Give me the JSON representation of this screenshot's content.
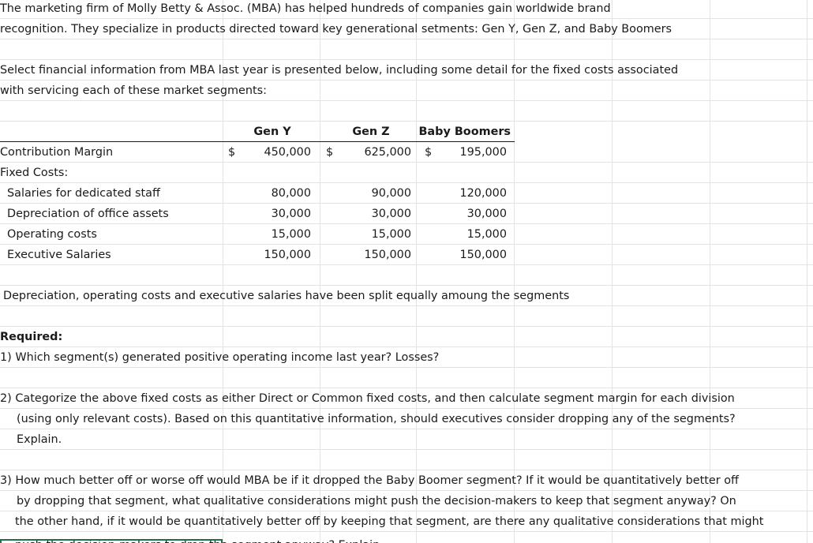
{
  "intro": {
    "line1": "The marketing firm of Molly Betty & Assoc. (MBA) has helped hundreds of companies gain worldwide brand",
    "line2": "recognition.  They specialize in products directed toward key generational setments: Gen Y, Gen Z, and Baby Boomers"
  },
  "select_info": {
    "line1": "Select financial information from MBA last year is presented below, including some detail for the fixed costs associated",
    "line2": "with servicing each of these market segments:"
  },
  "table": {
    "headers": [
      "Gen Y",
      "Gen Z",
      "Baby Boomers"
    ],
    "currency_symbol": "$",
    "rows": [
      {
        "label": "Contribution Margin",
        "values": [
          "450,000",
          "625,000",
          "195,000"
        ]
      },
      {
        "label": "Fixed Costs:",
        "values": [
          "",
          "",
          ""
        ]
      },
      {
        "label": "Salaries for dedicated staff",
        "values": [
          "80,000",
          "90,000",
          "120,000"
        ]
      },
      {
        "label": "Depreciation of office assets",
        "values": [
          "30,000",
          "30,000",
          "30,000"
        ]
      },
      {
        "label": "Operating costs",
        "values": [
          "15,000",
          "15,000",
          "15,000"
        ]
      },
      {
        "label": "Executive Salaries",
        "values": [
          "150,000",
          "150,000",
          "150,000"
        ]
      }
    ]
  },
  "note": "Depreciation, operating costs and executive salaries have been split equally amoung the segments",
  "required": {
    "heading": "Required:",
    "q1": "1) Which segment(s) generated positive operating income last year? Losses?",
    "q2_line1": "2) Categorize the above fixed costs as either Direct or Common fixed costs, and then calculate segment margin for each division",
    "q2_line2": "(using only relevant costs).  Based on this quantitative information, should executives consider dropping any of the segments?",
    "q2_line3": "Explain.",
    "q3_line1": "3) How much better off or worse off would MBA be if it dropped the Baby Boomer segment?  If it would be quantitatively better off",
    "q3_line2": "by dropping that segment, what qualitative considerations might push the decision-makers to keep that segment anyway?  On",
    "q3_line3": "the other hand, if it would be quantitatively better off by keeping that segment, are there any qualitative considerations that might",
    "q3_line4": "push the decision-makers to drop the segment anyway?  Explain."
  }
}
